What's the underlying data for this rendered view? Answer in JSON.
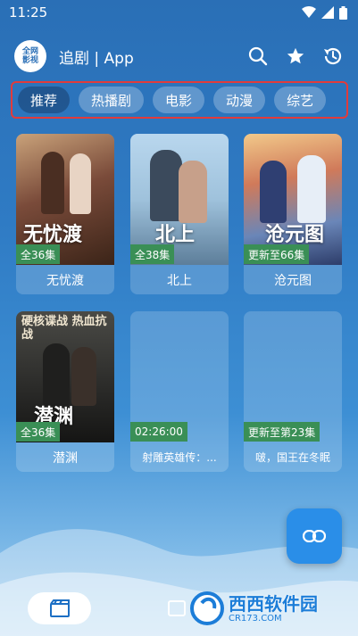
{
  "status": {
    "time": "11:25"
  },
  "app": {
    "logo_text": "全网影视",
    "title": "追剧 | App"
  },
  "icons": {
    "search": "search-icon",
    "favorite": "star-icon",
    "history": "history-icon",
    "link": "link-icon",
    "movie": "film-icon"
  },
  "tabs": [
    {
      "label": "推荐"
    },
    {
      "label": "热播剧"
    },
    {
      "label": "电影"
    },
    {
      "label": "动漫"
    },
    {
      "label": "综艺"
    }
  ],
  "cards": [
    {
      "title": "无忧渡",
      "badge": "全36集",
      "poster_text": "无忧渡"
    },
    {
      "title": "北上",
      "badge": "全38集",
      "poster_text": "北上"
    },
    {
      "title": "沧元图",
      "badge": "更新至66集",
      "poster_text": "沧元图"
    },
    {
      "title": "潜渊",
      "badge": "全36集",
      "poster_text": "潜渊",
      "poster_subtext": "硬核谍战 热血抗战"
    },
    {
      "title": "射雕英雄传：...",
      "badge": "02:26:00"
    },
    {
      "title": "啵，国王在冬眠",
      "badge": "更新至第23集"
    }
  ],
  "watermark": {
    "text": "西西软件园",
    "sub": "CR173.COM"
  },
  "colors": {
    "accent": "#2a8ee8",
    "badge": "#3a8f56",
    "tab_border": "#e23b3b"
  }
}
